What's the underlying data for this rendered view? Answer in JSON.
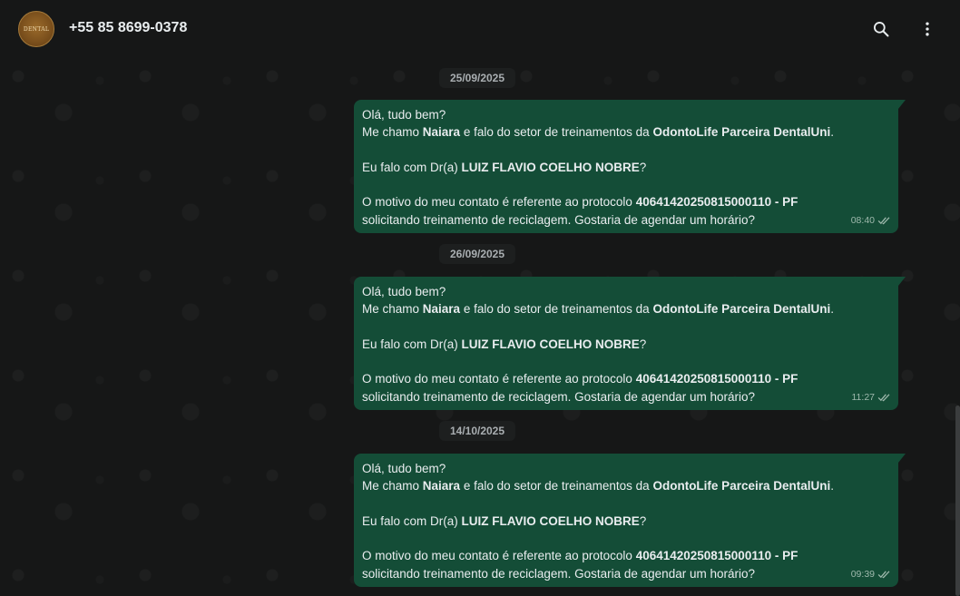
{
  "header": {
    "contact_name": "+55 85 8699-0378",
    "avatar_text": "DENTAL"
  },
  "icons": {
    "search": "search-icon",
    "menu": "kebab-menu-icon",
    "ticks": "double-check-icon"
  },
  "colors": {
    "background": "#161717",
    "bubble_outgoing": "#144d37",
    "text": "#e9edef",
    "date_pill": "#1d1f1f"
  },
  "messages": [
    {
      "date": "25/09/2025",
      "greeting": "Olá, tudo bem?",
      "intro_1": "Me chamo ",
      "name": "Naiara",
      "intro_2": " e falo do setor de treinamentos da ",
      "company": "OdontoLife Parceira DentalUni",
      "intro_end": ".",
      "question_1": "Eu falo com Dr(a) ",
      "doctor": "LUIZ FLAVIO COELHO NOBRE",
      "question_end": "?",
      "reason_1": "O motivo do meu contato é referente ao protocolo ",
      "protocol": "40641420250815000110 - PF",
      "reason_2": "solicitando treinamento de reciclagem. Gostaria de agendar um horário?",
      "time": "08:40"
    },
    {
      "date": "26/09/2025",
      "greeting": "Olá, tudo bem?",
      "intro_1": "Me chamo ",
      "name": "Naiara",
      "intro_2": " e falo do setor de treinamentos da ",
      "company": "OdontoLife Parceira DentalUni",
      "intro_end": ".",
      "question_1": "Eu falo com Dr(a) ",
      "doctor": "LUIZ FLAVIO COELHO NOBRE",
      "question_end": "?",
      "reason_1": "O motivo do meu contato é referente ao protocolo ",
      "protocol": "40641420250815000110 - PF",
      "reason_2": "solicitando treinamento de reciclagem. Gostaria de agendar um horário?",
      "time": "11:27"
    },
    {
      "date": "14/10/2025",
      "greeting": "Olá, tudo bem?",
      "intro_1": "Me chamo ",
      "name": "Naiara",
      "intro_2": " e falo do setor de treinamentos da ",
      "company": "OdontoLife Parceira DentalUni",
      "intro_end": ".",
      "question_1": "Eu falo com Dr(a) ",
      "doctor": "LUIZ FLAVIO COELHO NOBRE",
      "question_end": "?",
      "reason_1": "O motivo do meu contato é referente ao protocolo ",
      "protocol": "40641420250815000110 - PF",
      "reason_2": "solicitando treinamento de reciclagem. Gostaria de agendar um horário?",
      "time": "09:39"
    }
  ]
}
